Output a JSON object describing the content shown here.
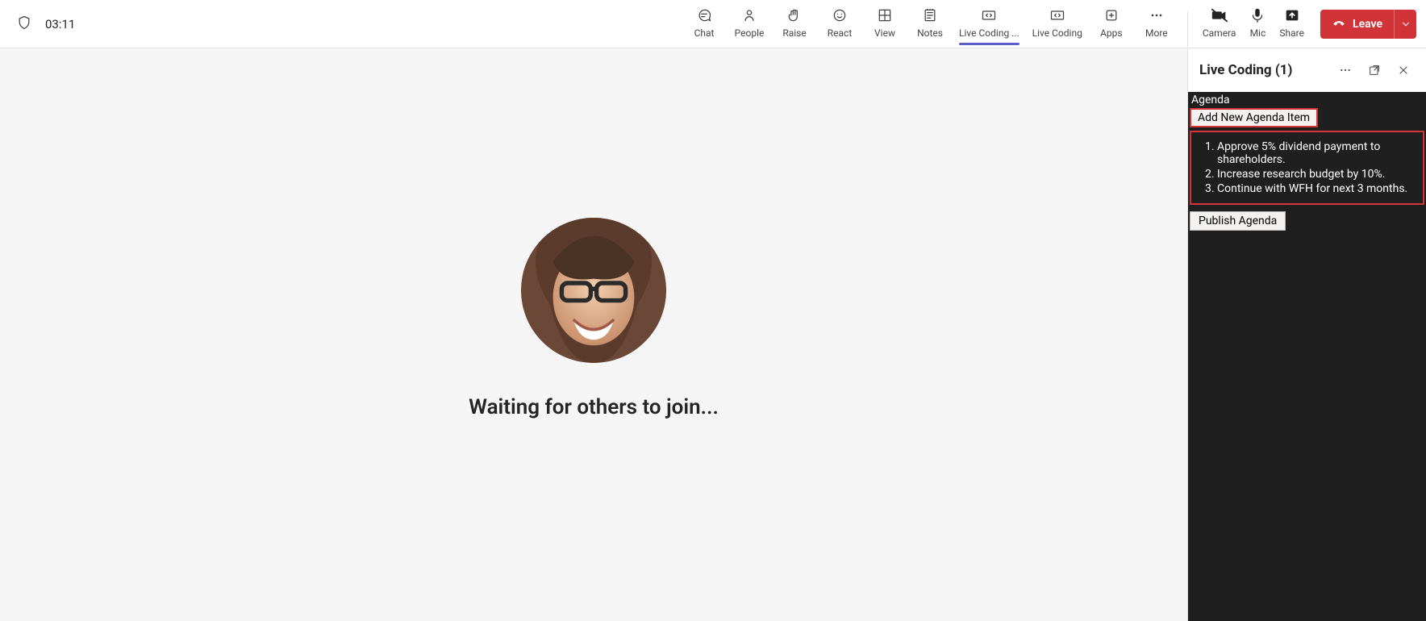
{
  "meeting": {
    "elapsed": "03:11",
    "waiting_text": "Waiting for others to join..."
  },
  "toolbar": {
    "chat": "Chat",
    "people": "People",
    "raise": "Raise",
    "react": "React",
    "view": "View",
    "notes": "Notes",
    "livecoding1": "Live Coding ...",
    "livecoding2": "Live Coding",
    "apps": "Apps",
    "more": "More",
    "camera": "Camera",
    "mic": "Mic",
    "share": "Share",
    "leave": "Leave"
  },
  "sidepanel": {
    "title": "Live Coding (1)",
    "agenda_heading": "Agenda",
    "add_button": "Add New Agenda Item",
    "items": [
      "Approve 5% dividend payment to shareholders.",
      "Increase research budget by 10%.",
      "Continue with WFH for next 3 months."
    ],
    "publish_button": "Publish Agenda"
  }
}
